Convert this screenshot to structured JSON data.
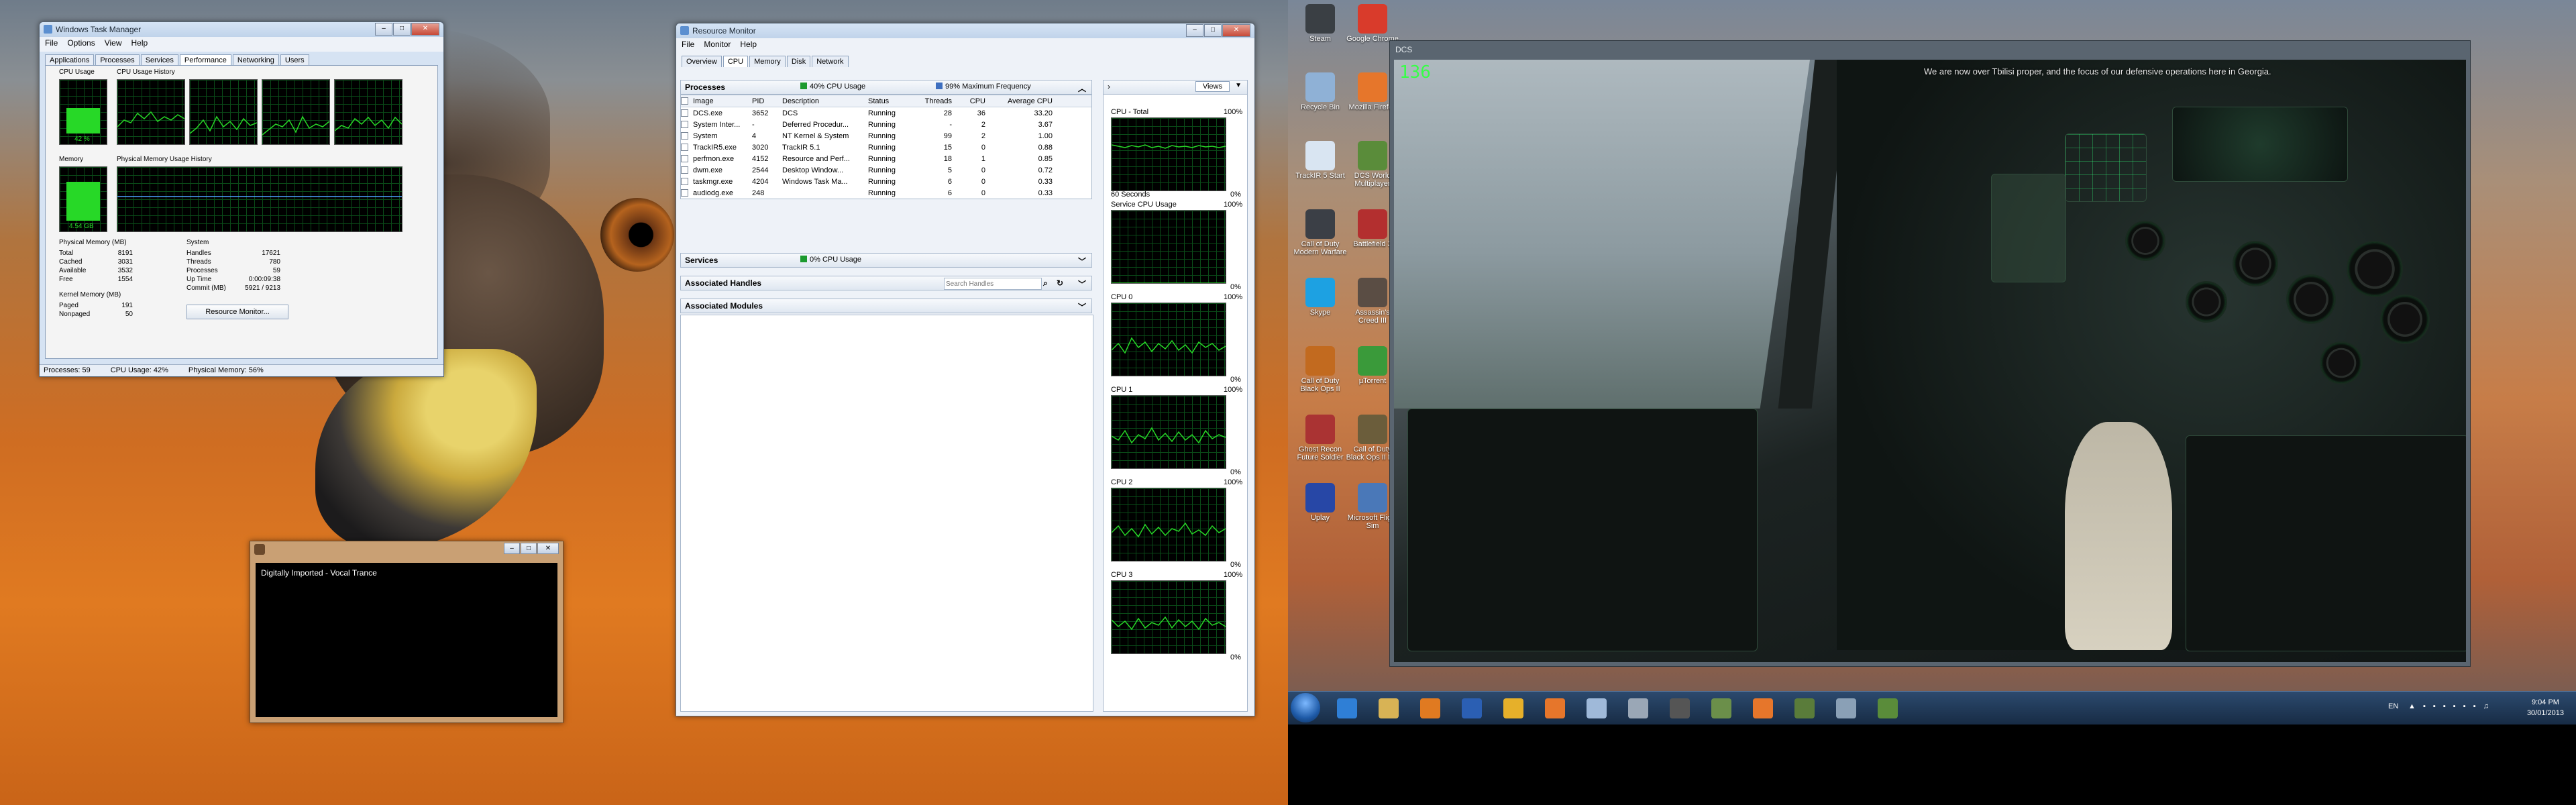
{
  "task_manager": {
    "title": "Windows Task Manager",
    "menu": [
      "File",
      "Options",
      "View",
      "Help"
    ],
    "tabs": [
      "Applications",
      "Processes",
      "Services",
      "Performance",
      "Networking",
      "Users"
    ],
    "active_tab": "Performance",
    "cpu_usage_label": "CPU Usage",
    "cpu_usage_value": "42 %",
    "cpu_history_label": "CPU Usage History",
    "memory_label": "Memory",
    "memory_value": "4.54 GB",
    "phys_history_label": "Physical Memory Usage History",
    "physical_memory_header": "Physical Memory (MB)",
    "physical_memory": [
      {
        "k": "Total",
        "v": "8191"
      },
      {
        "k": "Cached",
        "v": "3031"
      },
      {
        "k": "Available",
        "v": "3532"
      },
      {
        "k": "Free",
        "v": "1554"
      }
    ],
    "kernel_memory_header": "Kernel Memory (MB)",
    "kernel_memory": [
      {
        "k": "Paged",
        "v": "191"
      },
      {
        "k": "Nonpaged",
        "v": "50"
      }
    ],
    "system_header": "System",
    "system": [
      {
        "k": "Handles",
        "v": "17621"
      },
      {
        "k": "Threads",
        "v": "780"
      },
      {
        "k": "Processes",
        "v": "59"
      },
      {
        "k": "Up Time",
        "v": "0:00:09:38"
      },
      {
        "k": "Commit (MB)",
        "v": "5921 / 9213"
      }
    ],
    "resource_monitor_button": "Resource Monitor...",
    "status": {
      "processes": "Processes: 59",
      "cpu": "CPU Usage: 42%",
      "memory": "Physical Memory: 56%"
    }
  },
  "resource_monitor": {
    "title": "Resource Monitor",
    "menu": [
      "File",
      "Monitor",
      "Help"
    ],
    "tabs": [
      "Overview",
      "CPU",
      "Memory",
      "Disk",
      "Network"
    ],
    "active_tab": "CPU",
    "processes_section": {
      "title": "Processes",
      "cpu": "40% CPU Usage",
      "freq": "99% Maximum Frequency"
    },
    "columns": [
      "Image",
      "PID",
      "Description",
      "Status",
      "Threads",
      "CPU",
      "Average CPU"
    ],
    "rows": [
      [
        "DCS.exe",
        "3652",
        "DCS",
        "Running",
        "28",
        "36",
        "33.20"
      ],
      [
        "System Inter...",
        "-",
        "Deferred Procedur...",
        "Running",
        "-",
        "2",
        "3.67"
      ],
      [
        "System",
        "4",
        "NT Kernel & System",
        "Running",
        "99",
        "2",
        "1.00"
      ],
      [
        "TrackIR5.exe",
        "3020",
        "TrackIR 5.1",
        "Running",
        "15",
        "0",
        "0.88"
      ],
      [
        "perfmon.exe",
        "4152",
        "Resource and Perf...",
        "Running",
        "18",
        "1",
        "0.85"
      ],
      [
        "dwm.exe",
        "2544",
        "Desktop Window...",
        "Running",
        "5",
        "0",
        "0.72"
      ],
      [
        "taskmgr.exe",
        "4204",
        "Windows Task Ma...",
        "Running",
        "6",
        "0",
        "0.33"
      ],
      [
        "audiodg.exe",
        "248",
        "",
        "Running",
        "6",
        "0",
        "0.33"
      ]
    ],
    "services_section": {
      "title": "Services",
      "cpu": "0% CPU Usage"
    },
    "handles_section": {
      "title": "Associated Handles",
      "search_placeholder": "Search Handles"
    },
    "modules_section": {
      "title": "Associated Modules"
    },
    "views_button": "Views",
    "graphs": [
      {
        "name": "CPU - Total",
        "max": "100%",
        "foot_left": "60 Seconds",
        "foot_right": "0%"
      },
      {
        "name": "Service CPU Usage",
        "max": "100%",
        "foot_left": "",
        "foot_right": "0%"
      },
      {
        "name": "CPU 0",
        "max": "100%",
        "foot_left": "",
        "foot_right": "0%"
      },
      {
        "name": "CPU 1",
        "max": "100%",
        "foot_left": "",
        "foot_right": "0%"
      },
      {
        "name": "CPU 2",
        "max": "100%",
        "foot_left": "",
        "foot_right": "0%"
      },
      {
        "name": "CPU 3",
        "max": "100%",
        "foot_left": "",
        "foot_right": "0%"
      }
    ]
  },
  "music_window": {
    "text": "Digitally Imported - Vocal Trance"
  },
  "desktop_icons": [
    {
      "label": "Steam",
      "color": "#3a3f44"
    },
    {
      "label": "Google Chrome",
      "color": "#d93b2b"
    },
    {
      "label": "Recycle Bin",
      "color": "#8fb1d6"
    },
    {
      "label": "Mozilla Firefox",
      "color": "#e6762b"
    },
    {
      "label": "TrackIR 5 Start",
      "color": "#d9e5f2"
    },
    {
      "label": "DCS World Multiplayer",
      "color": "#5a8c3a"
    },
    {
      "label": "Call of Duty Modern Warfare",
      "color": "#3b3f46"
    },
    {
      "label": "Battlefield 3",
      "color": "#b32f2f"
    },
    {
      "label": "Skype",
      "color": "#1da1e2"
    },
    {
      "label": "Assassin's Creed III",
      "color": "#5a4d44"
    },
    {
      "label": "Call of Duty Black Ops II",
      "color": "#c26a1f"
    },
    {
      "label": "µTorrent",
      "color": "#3a9a3a"
    },
    {
      "label": "Ghost Recon Future Soldier",
      "color": "#a33"
    },
    {
      "label": "Call of Duty Black Ops II MP",
      "color": "#6b5d3b"
    },
    {
      "label": "Uplay",
      "color": "#2747a6"
    },
    {
      "label": "Microsoft Flight Sim",
      "color": "#4a78b8"
    }
  ],
  "dcs_window": {
    "title": "DCS",
    "fps": "136",
    "subtitle": "We are now over Tbilisi proper, and the focus of our defensive operations here in Georgia."
  },
  "taskbar": {
    "lang": "EN",
    "time": "9:04 PM",
    "date": "30/01/2013",
    "items": [
      {
        "name": "ie",
        "color": "#2f7fd6"
      },
      {
        "name": "explorer",
        "color": "#d8b355"
      },
      {
        "name": "media-player",
        "color": "#e07a21"
      },
      {
        "name": "word",
        "color": "#2b5fb3"
      },
      {
        "name": "outlook-like",
        "color": "#e6b02a"
      },
      {
        "name": "firefox",
        "color": "#e6762b"
      },
      {
        "name": "paint",
        "color": "#9fb9d9"
      },
      {
        "name": "settings",
        "color": "#9aa7b6"
      },
      {
        "name": "dcs",
        "color": "#555"
      },
      {
        "name": "calculator",
        "color": "#6b8f4a"
      },
      {
        "name": "firefox-2",
        "color": "#e6762b"
      },
      {
        "name": "task-manager",
        "color": "#5a7c3a"
      },
      {
        "name": "resource-monitor",
        "color": "#8aa0b6"
      },
      {
        "name": "dcs-world",
        "color": "#5a8c3a"
      }
    ]
  }
}
